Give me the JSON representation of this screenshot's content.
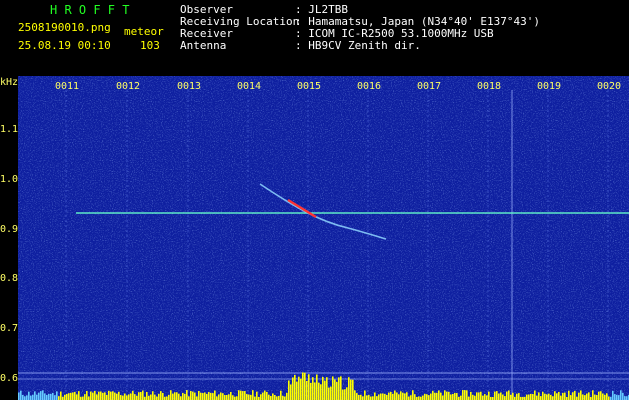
{
  "header": {
    "brand": "H R O F F T",
    "filename": "2508190010.png",
    "mode": "meteor",
    "datetime": "25.08.19 00:10",
    "count": "103",
    "labels": [
      "Observer",
      "Receiving Location",
      "Receiver",
      "Antenna"
    ],
    "values": [
      ": JL2TBB",
      ": Hamamatsu, Japan (N34°40' E137°43')",
      ": ICOM IC-R2500 53.1000MHz USB",
      ": HB9CV Zenith dir."
    ]
  },
  "axis": {
    "unit": "kHz",
    "time_ticks": [
      "0011",
      "0012",
      "0013",
      "0014",
      "0015",
      "0016",
      "0017",
      "0018",
      "0019",
      "0020"
    ],
    "freq_ticks": [
      "1.1",
      "1.0",
      "0.9",
      "0.8",
      "0.7",
      "0.6"
    ]
  },
  "colors": {
    "background": "#0e1fa0",
    "trace": "#66ffcc",
    "head": "#ff3333",
    "level": "#ffff00",
    "text": "#ffff66"
  }
}
